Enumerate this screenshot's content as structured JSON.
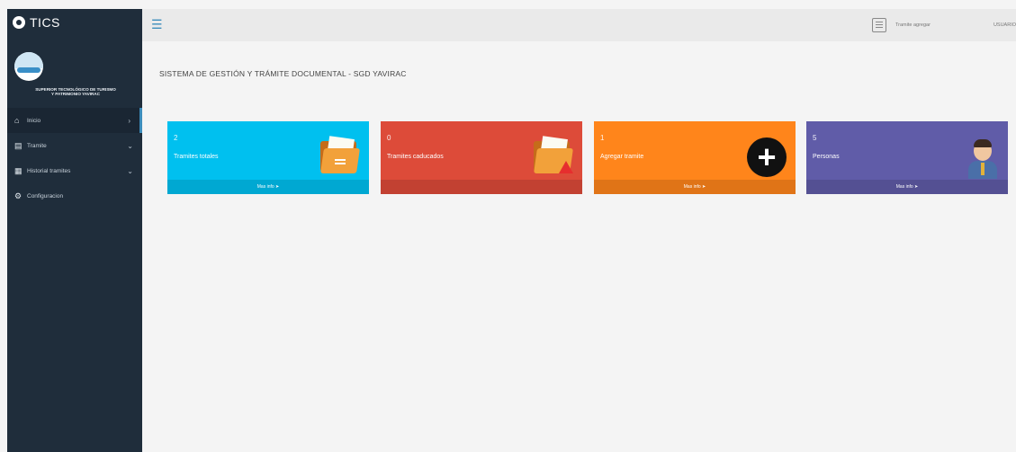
{
  "app": {
    "brand": "TICS"
  },
  "sidebar": {
    "institution_line1": "SUPERIOR TECNOLÓGICO DE TURISMO",
    "institution_line2": "Y PATRIMONIO YAVIRAC",
    "items": [
      {
        "icon": "home-icon",
        "label": "Inicio",
        "active": true
      },
      {
        "icon": "file-icon",
        "label": "Tramite"
      },
      {
        "icon": "calendar-icon",
        "label": "Historial tramites"
      },
      {
        "icon": "gear-icon",
        "label": "Configuracion"
      }
    ]
  },
  "topbar": {
    "menu_icon": "hamburger-icon",
    "action_label": "Tramite agregar",
    "user_label": "USUARIO"
  },
  "main": {
    "title": "SISTEMA DE GESTIÓN Y TRÁMITE DOCUMENTAL - SGD YAVIRAC",
    "boxes": [
      {
        "number": "2",
        "label": "Tramites totales",
        "footer": "Mas info",
        "color": "#00c0ef",
        "icon": "folder-icon"
      },
      {
        "number": "0",
        "label": "Tramites caducados",
        "footer": "",
        "color": "#dd4b39",
        "icon": "folder-warning-icon"
      },
      {
        "number": "1",
        "label": "Agregar tramite",
        "footer": "Mas info",
        "color": "#ff851b",
        "icon": "plus-circle-icon"
      },
      {
        "number": "5",
        "label": "Personas",
        "footer": "Mas info",
        "color": "#605ca8",
        "icon": "person-icon"
      }
    ]
  }
}
